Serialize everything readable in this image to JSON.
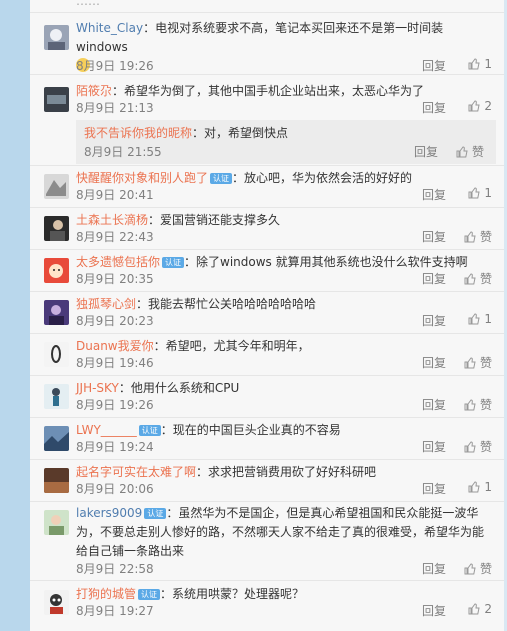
{
  "actions": {
    "reply": "回复",
    "like": "赞"
  },
  "comments": [
    {
      "user": "White_Clay",
      "text": "：电视对系统要求不高，笔记本买回来还不是第一时间装windows",
      "time": "8月9日 19:26",
      "likes": "1"
    },
    {
      "user": "陌筱尕",
      "text": "：希望华为倒了，其他中国手机企业站出来，太恶心华为了",
      "time": "8月9日 21:13",
      "likes": "2"
    },
    {
      "user": "我不告诉你我的昵称",
      "text": "：对，希望倒快点",
      "time": "8月9日 21:55",
      "likes": "赞"
    },
    {
      "user": "快醒醒你对象和别人跑了",
      "verified": "认证",
      "text": "：放心吧，华为依然会活的好好的",
      "time": "8月9日 20:41",
      "likes": "1"
    },
    {
      "user": "土森土长滴杨",
      "text": "：爱国营销还能支撑多久",
      "time": "8月9日 22:43",
      "likes": "赞"
    },
    {
      "user": "太多遗憾包括你",
      "verified": "认证",
      "text": "：除了windows 就算用其他系统也没什么软件支持啊",
      "time": "8月9日 20:35",
      "likes": "赞"
    },
    {
      "user": "独孤琴心剑",
      "text": "：我能去帮忙公关哈哈哈哈哈哈哈",
      "time": "8月9日 20:23",
      "likes": "1"
    },
    {
      "user": "Duanw我爱你",
      "text": "：希望吧，尤其今年和明年，",
      "time": "8月9日 19:46",
      "likes": "赞"
    },
    {
      "user": "JJH-SKY",
      "text": "：他用什么系统和CPU",
      "time": "8月9日 19:26",
      "likes": "赞"
    },
    {
      "user": "LWY______",
      "verified": "认证",
      "text": "：现在的中国巨头企业真的不容易",
      "time": "8月9日 19:24",
      "likes": "赞"
    },
    {
      "user": "起名字可实在太难了啊",
      "text": "：求求把营销费用砍了好好科研吧",
      "time": "8月9日 20:06",
      "likes": "1"
    },
    {
      "user": "lakers9009",
      "verified": "认证",
      "text": "：虽然华为不是国企，但是真心希望祖国和民众能挺一波华为，不要总走别人惨好的路，不然哪天人家不给走了真的很难受，希望华为能给自己铺一条路出来",
      "time": "8月9日 22:58",
      "likes": "赞"
    },
    {
      "user": "打狗的城管",
      "verified": "认证",
      "text": "：系统用哄蒙？处理器呢？",
      "time": "8月9日 19:27",
      "likes": "2"
    }
  ],
  "colors": {
    "username": "#eb7350",
    "username_alt": "#507daf",
    "text": "#333333",
    "meta": "#808080",
    "background": "#f7f7f7"
  }
}
